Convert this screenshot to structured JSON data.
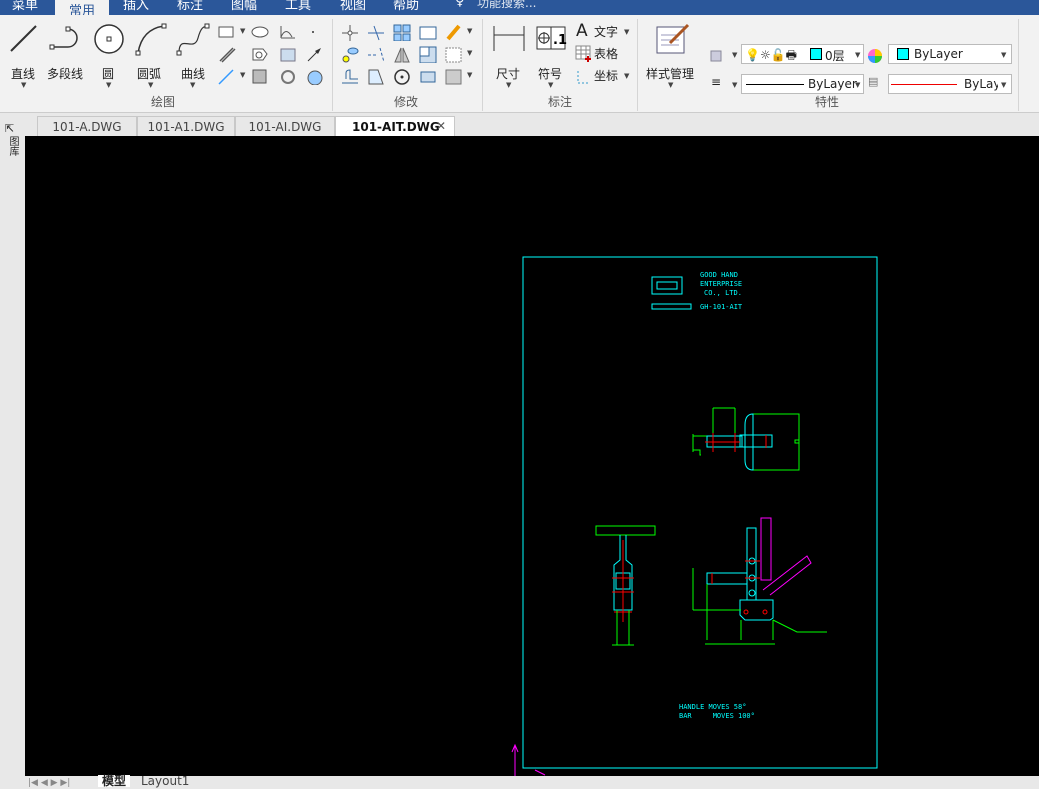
{
  "menubar": {
    "items": [
      "菜单",
      "常用",
      "插入",
      "标注",
      "图幅",
      "工具",
      "视图",
      "帮助"
    ],
    "active": "常用",
    "search_placeholder": "功能搜索..."
  },
  "ribbon": {
    "draw": {
      "label": "绘图",
      "line": "直线",
      "polyline": "多段线",
      "circle": "圆",
      "arc": "圆弧",
      "curve": "曲线"
    },
    "modify": {
      "label": "修改"
    },
    "annotate": {
      "label": "标注",
      "dimension": "尺寸",
      "symbol": "符号",
      "text": "文字",
      "table": "表格",
      "coord": "坐标"
    },
    "properties": {
      "label": "特性",
      "style_manager": "样式管理",
      "layer": "0层",
      "color": "ByLayer",
      "linetype": "ByLayer",
      "lineweight": "ByLayе",
      "layer_color": "#00ffff"
    }
  },
  "doc_tabs": [
    {
      "label": "101-A.DWG"
    },
    {
      "label": "101-A1.DWG"
    },
    {
      "label": "101-AI.DWG"
    },
    {
      "label": "101-AIT.DWG",
      "active": true
    }
  ],
  "left_strip": {
    "label": "图库"
  },
  "drawing": {
    "company": [
      "GOOD HAND",
      "ENTERPRISE",
      "CO., LTD."
    ],
    "part_no": "GH-101-AIT",
    "notes": [
      "HANDLE MOVES 58°",
      "BAR     MOVES 100°"
    ]
  },
  "layout_tabs": [
    "模型",
    "Layout1"
  ]
}
